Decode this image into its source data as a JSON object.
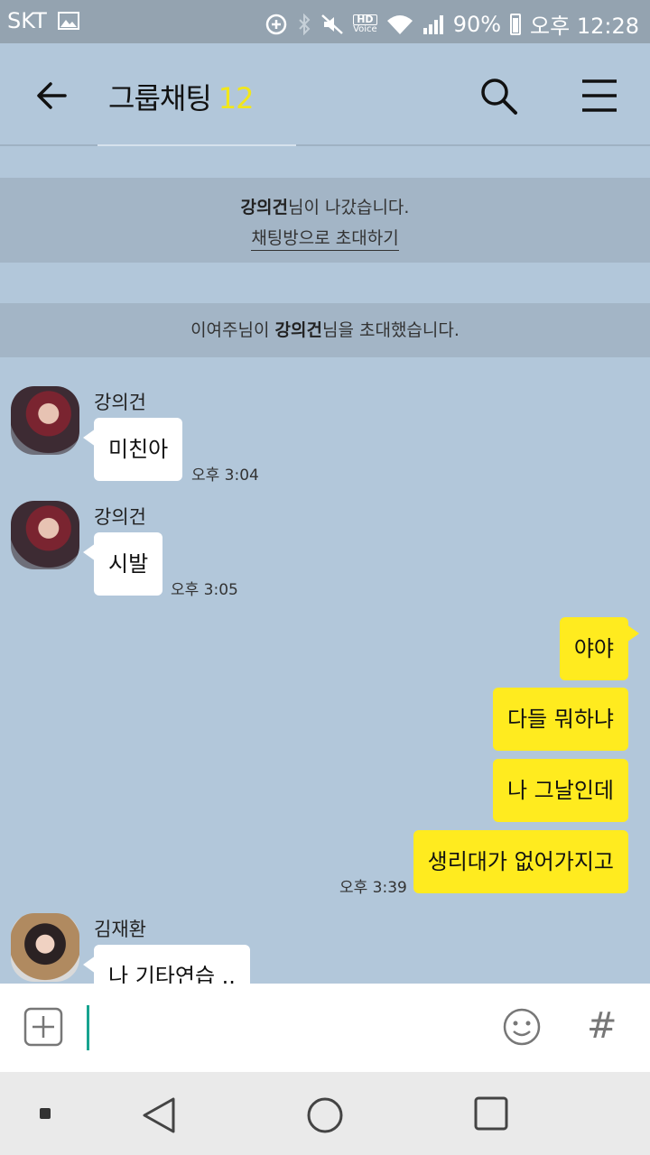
{
  "status_bar": {
    "carrier": "SKT",
    "hd_label": "HD",
    "hd_sub": "Voice",
    "battery": "90%",
    "time": "오후 12:28",
    "icons": [
      "gallery-icon",
      "data-saver-icon",
      "bluetooth-icon",
      "mute-icon",
      "wifi-icon",
      "signal-icon",
      "battery-icon"
    ]
  },
  "header": {
    "title": "그룹채팅",
    "member_count": "12"
  },
  "notices": {
    "left_name": "강의건",
    "left_text": "님이 나갔습니다.",
    "invite_link": "채팅방으로 초대하기",
    "invited_by": "이여주님이 ",
    "invited_name": "강의건",
    "invited_text": "님을 초대했습니다."
  },
  "messages": [
    {
      "sender": "강의건",
      "text": "미친아",
      "time": "오후 3:04"
    },
    {
      "sender": "강의건",
      "text": "시발",
      "time": "오후 3:05"
    },
    {
      "sender": "me",
      "text": "야야"
    },
    {
      "sender": "me",
      "text": "다들 뭐하냐"
    },
    {
      "sender": "me",
      "text": "나 그날인데"
    },
    {
      "sender": "me",
      "text": "생리대가 없어가지고",
      "time": "오후 3:39"
    },
    {
      "sender": "김재환",
      "text": "나 기타연습 .."
    }
  ],
  "input": {
    "value": "",
    "hash_label": "#"
  },
  "colors": {
    "chat_bg": "#b2c7da",
    "my_bubble": "#ffeb1f",
    "count_color": "#f2e71a",
    "cursor": "#17a38f"
  }
}
